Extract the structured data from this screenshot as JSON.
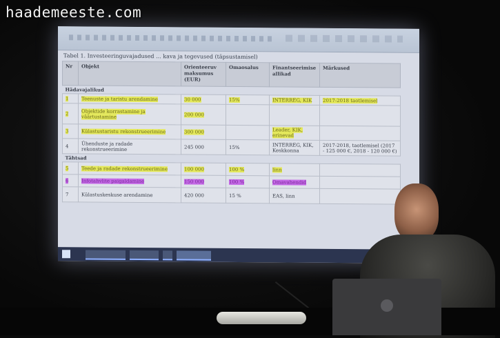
{
  "watermark": "haademeeste.com",
  "slide": {
    "caption": "Tabel 1. Investeeringuvajadused ... kava ja tegevused (täpsustamisel)",
    "columns": [
      "Nr",
      "Objekt",
      "Orienteeruv maksumus (EUR)",
      "Omaosalus",
      "Finantseerimise allikad",
      "Märkused"
    ],
    "sections": [
      {
        "title": "Hädavajalikud",
        "rows": [
          {
            "nr": "1",
            "objekt": "Teenuste ja taristu arendamine",
            "maksumus": "30 000",
            "omaosalus": "15%",
            "allikad": "INTERREG, KIK",
            "markused": "2017-2018 taotlemisel",
            "highlight": "yellow"
          },
          {
            "nr": "2",
            "objekt": "Objektide korrastamine ja väärtustamine",
            "maksumus": "200 000",
            "omaosalus": "",
            "allikad": "",
            "markused": "",
            "highlight": "yellow"
          },
          {
            "nr": "3",
            "objekt": "Külastustaristu rekonstrueerimine",
            "maksumus": "300 000",
            "omaosalus": "",
            "allikad": "Leader, KIK, erinevad",
            "markused": "",
            "highlight": "yellow"
          },
          {
            "nr": "4",
            "objekt": "Ühenduste ja radade rekonstrueerimine",
            "maksumus": "245 000",
            "omaosalus": "15%",
            "allikad": "INTERREG, KIK, Keskkonna",
            "markused": "2017-2018, taotlemisel (2017 - 125 000 €, 2018 - 120 000 €)",
            "highlight": "none"
          }
        ]
      },
      {
        "title": "Tähtsad",
        "rows": [
          {
            "nr": "5",
            "objekt": "Teede ja radade rekonstrueerimine",
            "maksumus": "100 000",
            "omaosalus": "100 %",
            "allikad": "linn",
            "markused": "",
            "highlight": "yellow"
          },
          {
            "nr": "6",
            "objekt": "Infotahvlite paigaldamine",
            "maksumus": "150 000",
            "omaosalus": "100 %",
            "allikad": "Omavahendid",
            "markused": "",
            "highlight": "purple"
          },
          {
            "nr": "7",
            "objekt": "Külastuskeskuse arendamine",
            "maksumus": "420 000",
            "omaosalus": "15 %",
            "allikad": "EAS, linn",
            "markused": "",
            "highlight": "none"
          }
        ]
      }
    ]
  },
  "taskbar": {
    "buttons": [
      "app-1",
      "app-2",
      "app-3",
      "app-4"
    ]
  }
}
